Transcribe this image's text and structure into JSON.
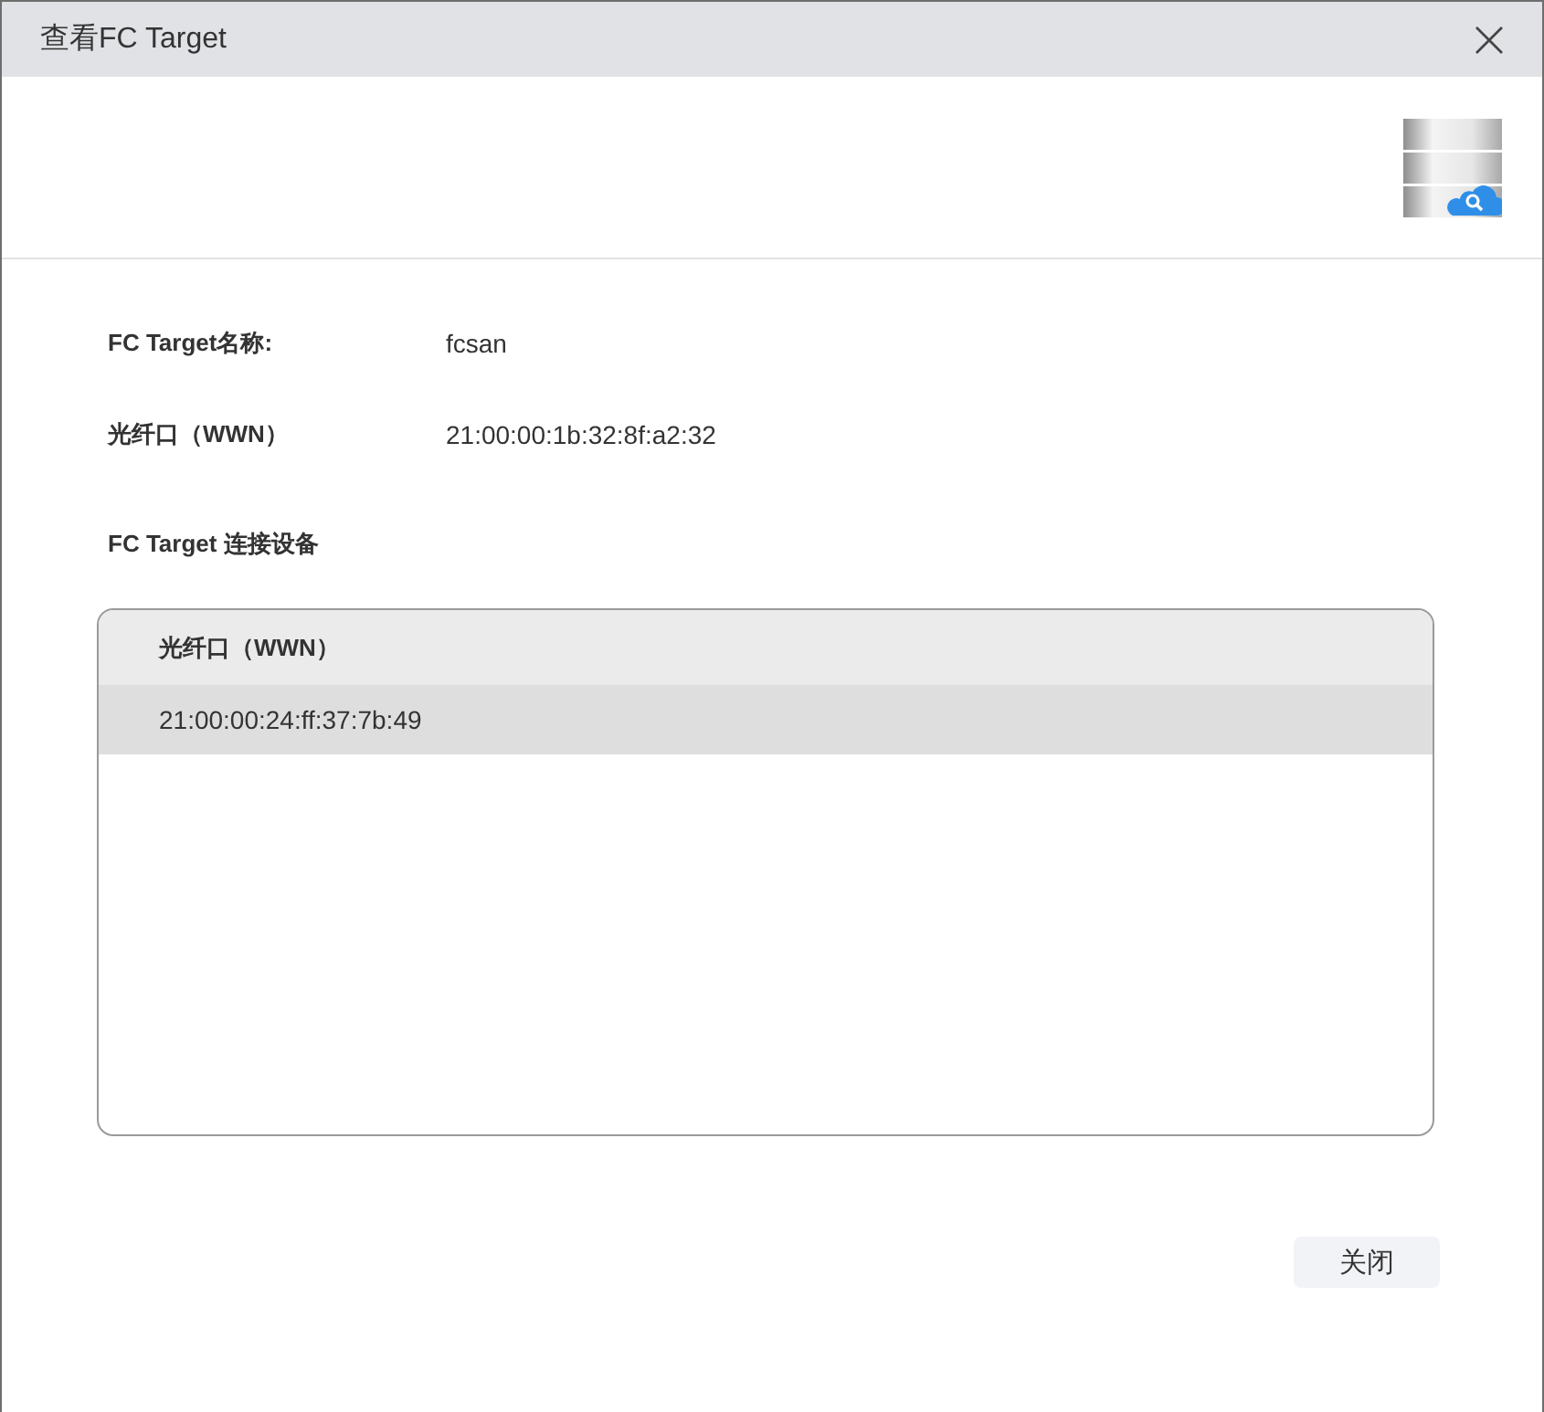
{
  "window": {
    "title": "查看FC Target"
  },
  "fields": [
    {
      "label": "FC Target名称:",
      "value": "fcsan"
    },
    {
      "label": "光纤口（WWN）",
      "value": "21:00:00:1b:32:8f:a2:32"
    }
  ],
  "section": {
    "title": "FC Target 连接设备"
  },
  "table": {
    "columns": [
      "光纤口（WWN）"
    ],
    "rows": [
      {
        "cells": [
          "21:00:00:24:ff:37:7b:49"
        ],
        "selected": true
      }
    ]
  },
  "buttons": [
    {
      "label": "关闭"
    }
  ]
}
